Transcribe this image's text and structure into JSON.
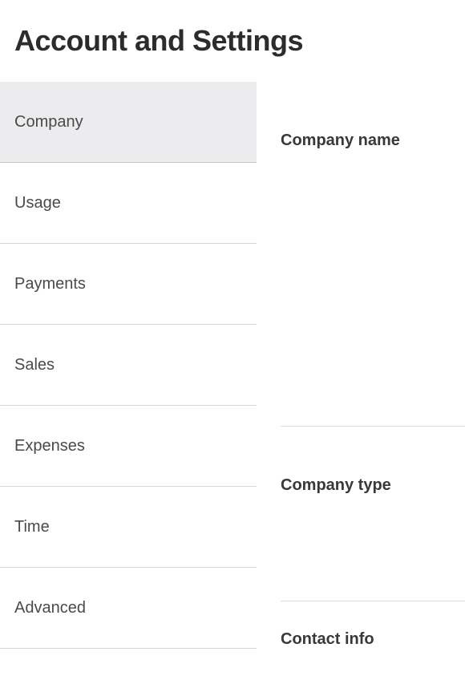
{
  "header": {
    "title": "Account and Settings"
  },
  "sidebar": {
    "items": [
      {
        "label": "Company",
        "active": true
      },
      {
        "label": "Usage",
        "active": false
      },
      {
        "label": "Payments",
        "active": false
      },
      {
        "label": "Sales",
        "active": false
      },
      {
        "label": "Expenses",
        "active": false
      },
      {
        "label": "Time",
        "active": false
      },
      {
        "label": "Advanced",
        "active": false
      }
    ]
  },
  "main": {
    "sections": [
      {
        "title": "Company name"
      },
      {
        "title": "Company type"
      },
      {
        "title": "Contact info"
      }
    ]
  }
}
